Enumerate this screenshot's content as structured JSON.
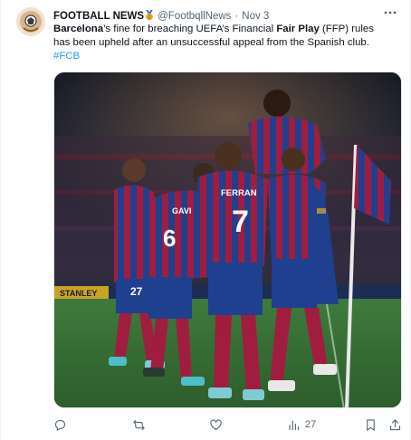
{
  "tweet": {
    "author_name": "FOOTBALL NEWS",
    "author_badge": "1st place medal",
    "handle": "@FootbqllNews",
    "separator": "·",
    "time": "Nov 3",
    "text_parts": [
      "Barcelona",
      "’s fine for breaching UEFA’s Financial ",
      "Fair Play",
      " (FFP) rules has been upheld after an unsuccessful appeal from the Spanish club."
    ],
    "hashtag": "#FCB",
    "media": {
      "jersey_names": [
        "FERRAN",
        "GAVI"
      ],
      "jersey_numbers": [
        "7",
        "6",
        "27"
      ],
      "ad_board": "STANLEY"
    },
    "stats": {
      "views": "27"
    }
  },
  "icons": {
    "more": "more-icon",
    "reply": "reply-icon",
    "retweet": "retweet-icon",
    "like": "like-icon",
    "views": "views-icon",
    "bookmark": "bookmark-icon",
    "share": "share-icon"
  },
  "colors": {
    "link": "#1d9bf0",
    "muted": "#536471",
    "text": "#0f1419",
    "kit_blue": "#1f3f8f",
    "kit_red": "#a3193a"
  }
}
